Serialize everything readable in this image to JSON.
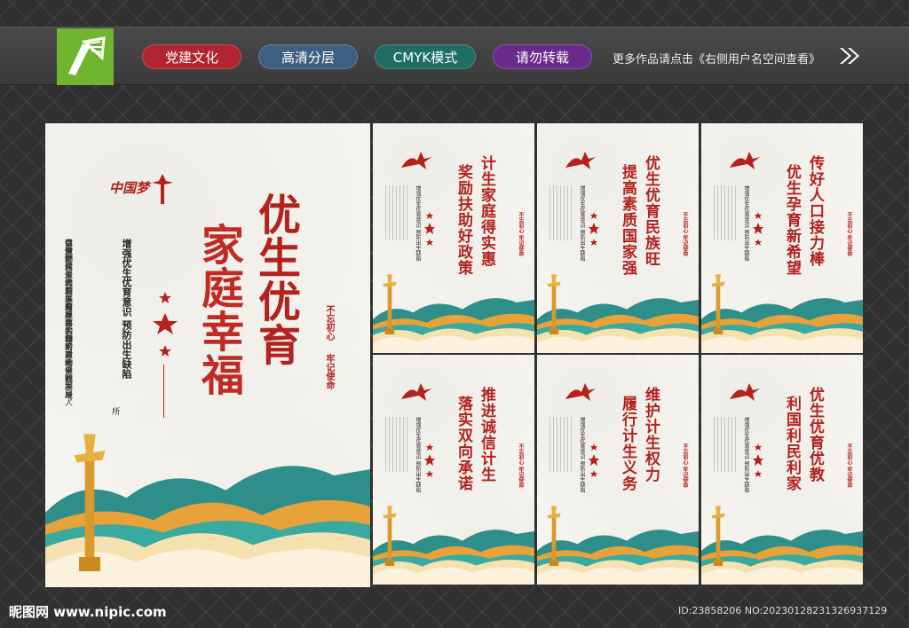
{
  "header": {
    "tags": [
      {
        "label": "党建文化",
        "color": "#b02530"
      },
      {
        "label": "高清分层",
        "color": "#3f5f80"
      },
      {
        "label": "CMYK模式",
        "color": "#1f6e66"
      },
      {
        "label": "请勿转载",
        "color": "#6a2a8a"
      }
    ],
    "promo": "更多作品请点击《右侧用户名空间查看》"
  },
  "main_poster": {
    "logo_text": "中国梦",
    "title_line1": "优生优育",
    "title_line2": "家庭幸福",
    "subtitle": "增强优生优育意识  预防出生缺陷",
    "body_cols": [
      "优生优育是计划生育具体内涵的延伸，我国是人",
      "口大国，巨大的人口压力会制约着社会的发展，",
      "以做好优生优育既是提高人口素质的重要手段，",
      "也是制约人口发展的重要手段，对未来社",
      "会整个民资的发展有重要的作用"
    ],
    "body_tail": "所",
    "slogan_a": "不忘初心",
    "slogan_b": "牢记使命"
  },
  "small_posters": [
    {
      "line1": "计生家庭得实惠",
      "line2": "奖励扶助好政策"
    },
    {
      "line1": "优生优育民族旺",
      "line2": "提高素质国家强"
    },
    {
      "line1": "传好人口接力棒",
      "line2": "优生孕育新希望"
    },
    {
      "line1": "推进诚信计生",
      "line2": "落实双向承诺"
    },
    {
      "line1": "维护计生权力",
      "line2": "履行计生义务"
    },
    {
      "line1": "优生优育优教",
      "line2": "利国利民利家"
    }
  ],
  "small_common": {
    "subtitle": "增强优生优育意识  预防出生缺陷",
    "slogan": "不忘初心 牢记使命"
  },
  "footer": {
    "site": "昵图网 www.nipic.com",
    "id_text": "ID:23858206 NO:20230128231326937129"
  }
}
